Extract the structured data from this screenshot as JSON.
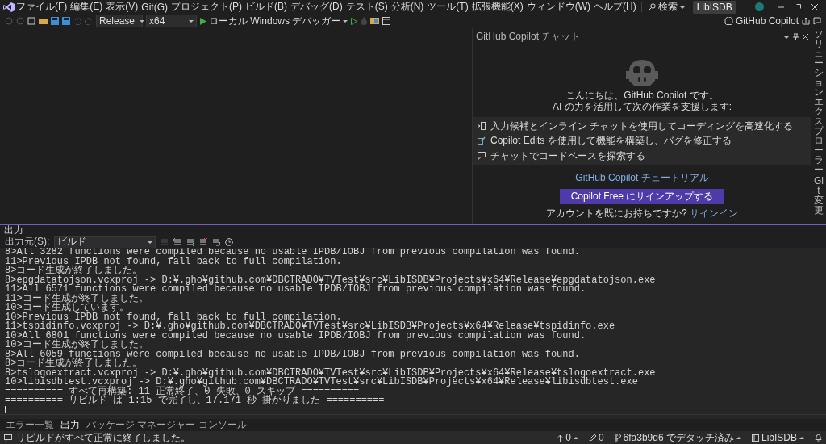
{
  "menu_bar": {
    "items": [
      "ファイル(F)",
      "編集(E)",
      "表示(V)",
      "Git(G)",
      "プロジェクト(P)",
      "ビルド(B)",
      "デバッグ(D)",
      "テスト(S)",
      "分析(N)",
      "ツール(T)",
      "拡張機能(X)",
      "ウィンドウ(W)",
      "ヘルプ(H)"
    ],
    "search": "検索",
    "solution_name": "LibISDB"
  },
  "toolbar": {
    "configuration": "Release",
    "platform": "x64",
    "debugger": "ローカル Windows デバッガー",
    "copilot_label": "GitHub Copilot"
  },
  "copilot_panel": {
    "title": "GitHub Copilot チャット",
    "greeting": [
      "こんにちは、GitHub Copilot です。",
      "AI の力を活用して次の作業を支援します:"
    ],
    "features": [
      {
        "kind": "suggest",
        "text": "入力候補とインライン チャットを使用してコーディングを高速化する"
      },
      {
        "kind": "edits",
        "text": "Copilot Edits を使用して機能を構築し、バグを修正する"
      },
      {
        "kind": "chat",
        "text": "チャットでコードベースを探索する"
      }
    ],
    "tutorial_link": "GitHub Copilot チュートリアル",
    "signup_button": "Copilot Free にサインアップする",
    "account_prompt": "アカウントを既にお持ちですか?",
    "signin_link": "サインイン"
  },
  "side_tabs": [
    "ソリューションエクスプローラー",
    "Git変更"
  ],
  "output_panel": {
    "title": "出力",
    "source_label": "出力元(S):",
    "source": "ビルド",
    "lines": [
      "8>All 3282 functions were compiled because no usable IPDB/IOBJ from previous compilation was found.",
      "11>Previous IPDB not found, fall back to full compilation.",
      "8>コード生成が終了しました。",
      "8>epgdatatojson.vcxproj -> D:¥.gho¥github.com¥DBCTRADO¥TVTest¥src¥LibISDB¥Projects¥x64¥Release¥epgdatatojson.exe",
      "11>All 6571 functions were compiled because no usable IPDB/IOBJ from previous compilation was found.",
      "11>コード生成が終了しました。",
      "10>コード生成しています。",
      "10>Previous IPDB not found, fall back to full compilation.",
      "11>tspidinfo.vcxproj -> D:¥.gho¥github.com¥DBCTRADO¥TVTest¥src¥LibISDB¥Projects¥x64¥Release¥tspidinfo.exe",
      "10>All 6801 functions were compiled because no usable IPDB/IOBJ from previous compilation was found.",
      "10>コード生成が終了しました。",
      "8>All 6059 functions were compiled because no usable IPDB/IOBJ from previous compilation was found.",
      "8>コード生成が終了しました。",
      "8>tslogoextract.vcxproj -> D:¥.gho¥github.com¥DBCTRADO¥TVTest¥src¥LibISDB¥Projects¥x64¥Release¥tslogoextract.exe",
      "10>libisdbtest.vcxproj -> D:¥.gho¥github.com¥DBCTRADO¥TVTest¥src¥LibISDB¥Projects¥x64¥Release¥libisdbtest.exe",
      "========== すべて再構築: 11 正常終了、0 失敗、0 スキップ ==========",
      "========== リビルド は 1:15 で完了し、17.171 秒 掛かりました =========="
    ]
  },
  "bottom_tabs": [
    {
      "label": "エラー一覧",
      "selected": false
    },
    {
      "label": "出力",
      "selected": true
    },
    {
      "label": "パッケージ マネージャー コンソール",
      "selected": false
    }
  ],
  "status_bar": {
    "message": "リビルドがすべて正常に終了しました。",
    "pending": "0",
    "edits": "0",
    "branch": "6fa3b9d6 でデタッチ済み",
    "repository": "LibISDB"
  }
}
